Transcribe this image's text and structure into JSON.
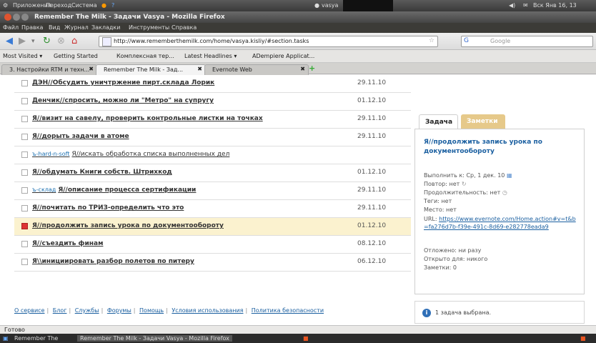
{
  "panel": {
    "menus": [
      "Приложения",
      "Переход",
      "Система"
    ],
    "user": "vasya",
    "clock": "Вск Янв 16, 13"
  },
  "window": {
    "title": "Remember The Milk - Задачи Vasya - Mozilla Firefox"
  },
  "menubar": {
    "items": [
      "Файл",
      "Правка",
      "Вид",
      "Журнал",
      "Закладки",
      "Инструменты",
      "Справка"
    ]
  },
  "navbar": {
    "url": "http://www.rememberthemilk.com/home/vasya.kisliy/#section.tasks",
    "search_placeholder": "Google"
  },
  "bookmarks": {
    "items": [
      "Most Visited ▾",
      "Getting Started",
      "Комплексная тер...",
      "Latest Headlines ▾",
      "ADempiere Applicat..."
    ]
  },
  "tabs": [
    {
      "label": "3. Настройки RTM и техн..."
    },
    {
      "label": "Remember The Milk - Зад..."
    },
    {
      "label": "Evernote Web"
    }
  ],
  "tasks": [
    {
      "tag": "",
      "name": "ДЭН//Обсудить уничтржение пирт.склада Лорик",
      "date": "29.11.10"
    },
    {
      "tag": "",
      "name": "Денчик//спросить, можно ли \"Метро\" на супругу",
      "date": "01.12.10"
    },
    {
      "tag": "",
      "name": "Я//визит на савелу, проверить контрольные листки на точках",
      "date": "29.11.10"
    },
    {
      "tag": "",
      "name": "Я//дорыть задачи в атоме",
      "date": "29.11.10"
    },
    {
      "tag": "ъ-hard-n-soft",
      "name": "Я//искать обработка списка выполненных дел",
      "date": ""
    },
    {
      "tag": "",
      "name": "Я//обдумать Книги собств. Штрихкод",
      "date": "01.12.10"
    },
    {
      "tag": "ъ-склад",
      "name": "Я//описание процесса сертификации",
      "date": "29.11.10"
    },
    {
      "tag": "",
      "name": "Я//почитать по ТРИЗ-определить что это",
      "date": "29.11.10"
    },
    {
      "tag": "",
      "name": "Я//продолжить запись урока по документообороту",
      "date": "01.12.10"
    },
    {
      "tag": "",
      "name": "Я//съездить финам",
      "date": "08.12.10"
    },
    {
      "tag": "",
      "name": "Я\\\\инициировать разбор полетов по питеру",
      "date": "06.12.10"
    }
  ],
  "footer_links": [
    "О сервисе",
    "Блог",
    "Службы",
    "Форумы",
    "Помощь",
    "Условия использования",
    "Политика безопасности"
  ],
  "detail": {
    "tab_task": "Задача",
    "tab_notes": "Заметки",
    "title": "Я//продолжить запись урока по документообороту",
    "due": "Выполнить к: Ср, 1 дек. 10",
    "repeat": "Повтор: нет",
    "duration": "Продолжительность: нет",
    "tags": "Теги: нет",
    "location": "Место: нет",
    "url_label": "URL:",
    "url": "https://www.evernote.com/Home.action#v=t&b=fa276d7b-f39e-491c-8d69-e282778eada9",
    "postponed": "Отложено: ни разу",
    "shared": "Открыто для: никого",
    "notes": "Заметки: 0"
  },
  "selection": {
    "text": "1 задача выбрана."
  },
  "status": {
    "text": "Готово"
  },
  "taskbar": {
    "item1": "Remember The",
    "item2": "Remember The Milk - Задачи Vasya - Mozilla Firefox"
  },
  "colors": {
    "link": "#1a5fa0",
    "selected_row": "#fbf2cf",
    "priority_flag": "#dd3333"
  }
}
